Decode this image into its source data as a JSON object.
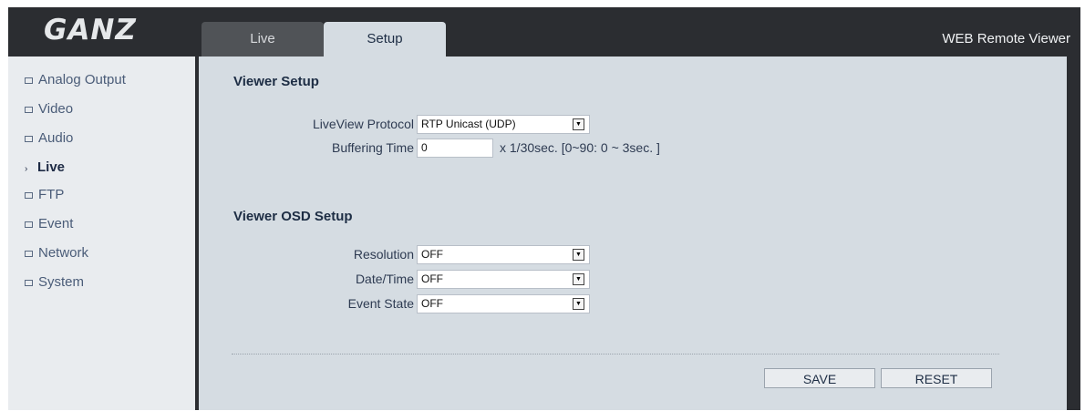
{
  "header": {
    "logo_text": "GANZ",
    "title": "WEB Remote Viewer",
    "tabs": [
      {
        "label": "Live",
        "active": false
      },
      {
        "label": "Setup",
        "active": true
      }
    ]
  },
  "sidebar": {
    "items": [
      {
        "label": "Analog Output"
      },
      {
        "label": "Video"
      },
      {
        "label": "Audio"
      },
      {
        "label": "Live",
        "active": true
      },
      {
        "label": "FTP"
      },
      {
        "label": "Event"
      },
      {
        "label": "Network"
      },
      {
        "label": "System"
      }
    ]
  },
  "viewer_setup": {
    "title": "Viewer Setup",
    "protocol": {
      "label": "LiveView Protocol",
      "value": "RTP Unicast (UDP)"
    },
    "buffering": {
      "label": "Buffering Time",
      "value": "0",
      "hint": "x 1/30sec. [0~90: 0 ~ 3sec. ]"
    }
  },
  "osd_setup": {
    "title": "Viewer OSD Setup",
    "resolution": {
      "label": "Resolution",
      "value": "OFF"
    },
    "datetime": {
      "label": "Date/Time",
      "value": "OFF"
    },
    "event_state": {
      "label": "Event State",
      "value": "OFF"
    }
  },
  "actions": {
    "save_label": "SAVE",
    "reset_label": "RESET"
  },
  "colors": {
    "frame": "#2b2d31",
    "panel": "#d5dce2",
    "sidebar": "#e9ecef",
    "heading": "#1d2d44"
  }
}
